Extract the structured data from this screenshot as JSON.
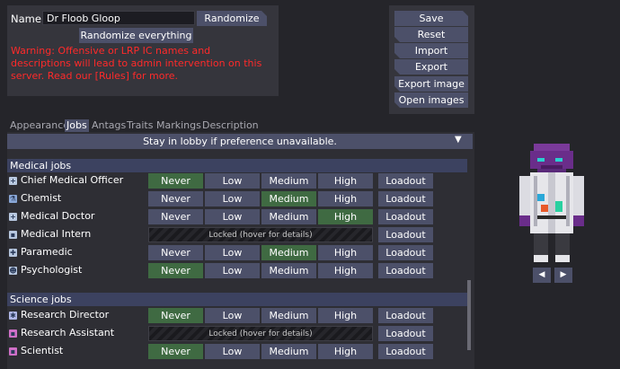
{
  "name_panel": {
    "label": "Name:",
    "name_value": "Dr Floob Gloop",
    "randomize": "Randomize",
    "randomize_everything": "Randomize everything",
    "warning": "Warning: Offensive or LRP IC names and descriptions will lead to admin intervention on this server. Read our [Rules] for more."
  },
  "actions": {
    "save": "Save",
    "reset": "Reset",
    "import": "Import",
    "export": "Export",
    "export_image": "Export image",
    "open_images": "Open images"
  },
  "tabs": [
    "Appearance",
    "Jobs",
    "Antags",
    "Traits",
    "Markings",
    "Description"
  ],
  "active_tab": "Jobs",
  "stay_in_lobby": "Stay in lobby if preference unavailable.",
  "priority_labels": [
    "Never",
    "Low",
    "Medium",
    "High"
  ],
  "loadout_label": "Loadout",
  "locked_label": "Locked (hover for details)",
  "sections": [
    {
      "title": "Medical jobs",
      "jobs": [
        {
          "name": "Chief Medical Officer",
          "selected": "Never"
        },
        {
          "name": "Chemist",
          "selected": "Medium"
        },
        {
          "name": "Medical Doctor",
          "selected": "High"
        },
        {
          "name": "Medical Intern",
          "locked": true
        },
        {
          "name": "Paramedic",
          "selected": "Medium"
        },
        {
          "name": "Psychologist",
          "selected": "Never"
        }
      ]
    },
    {
      "title": "Science jobs",
      "jobs": [
        {
          "name": "Research Director",
          "selected": "Never"
        },
        {
          "name": "Research Assistant",
          "locked": true
        },
        {
          "name": "Scientist",
          "selected": "Never"
        }
      ]
    }
  ],
  "colors": {
    "button": "#4c5069",
    "selected": "#3f6a42",
    "warning": "#ff2a2a",
    "section_header": "#3c4260"
  }
}
